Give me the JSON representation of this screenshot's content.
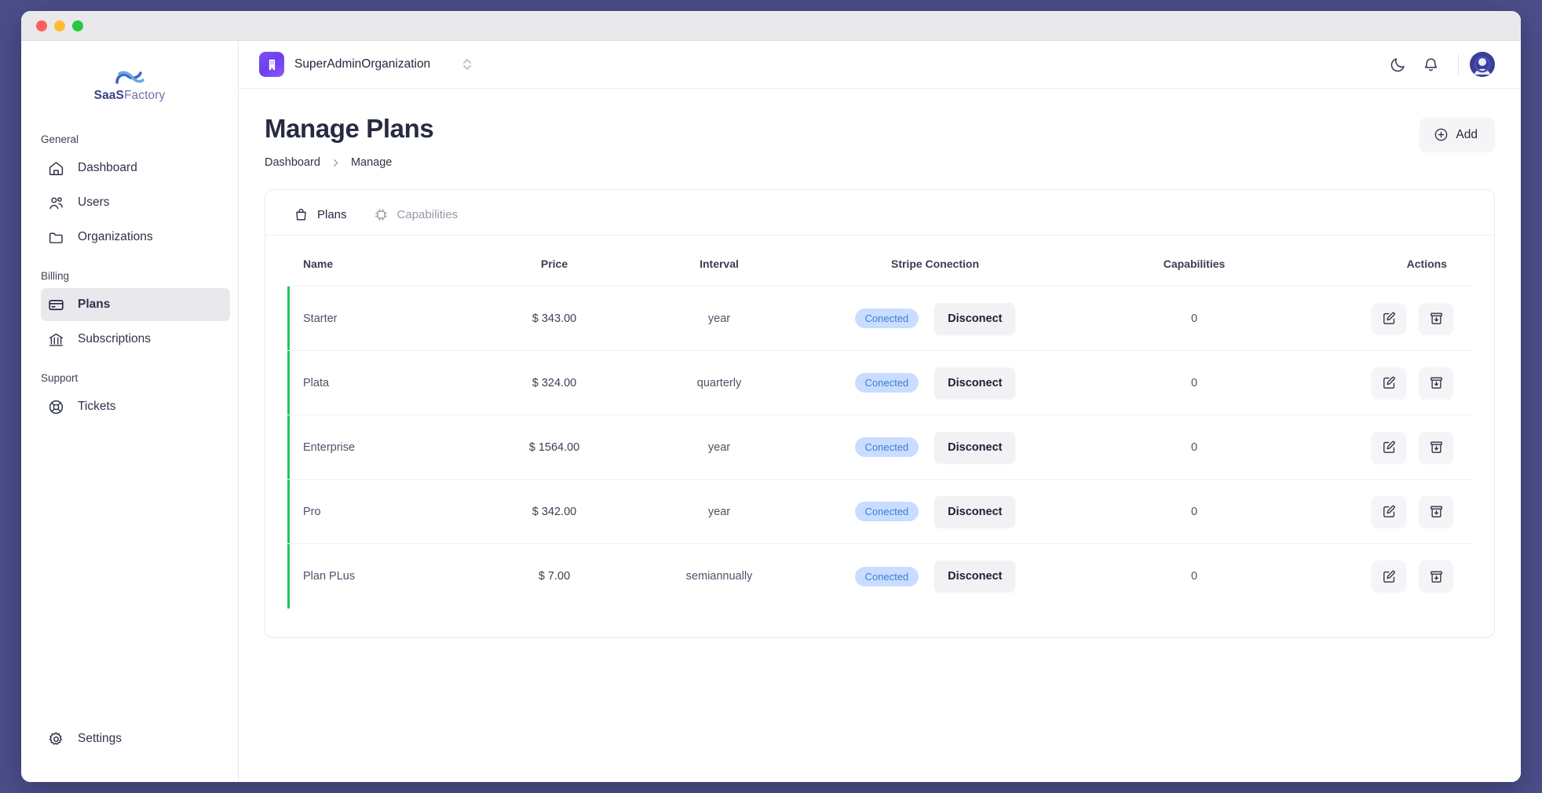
{
  "window": {
    "traffic_lights": [
      "close",
      "minimize",
      "zoom"
    ]
  },
  "sidebar": {
    "logo_bold": "SaaS",
    "logo_light": "Factory",
    "sections": [
      {
        "label": "General",
        "items": [
          {
            "label": "Dashboard",
            "icon": "home-icon",
            "active": false
          },
          {
            "label": "Users",
            "icon": "users-icon",
            "active": false
          },
          {
            "label": "Organizations",
            "icon": "folder-icon",
            "active": false
          }
        ]
      },
      {
        "label": "Billing",
        "items": [
          {
            "label": "Plans",
            "icon": "credit-card-icon",
            "active": true
          },
          {
            "label": "Subscriptions",
            "icon": "bank-icon",
            "active": false
          }
        ]
      },
      {
        "label": "Support",
        "items": [
          {
            "label": "Tickets",
            "icon": "lifebuoy-icon",
            "active": false
          }
        ]
      }
    ],
    "footer": {
      "label": "Settings",
      "icon": "gear-icon"
    }
  },
  "topbar": {
    "org_name": "SuperAdminOrganization",
    "org_icon": "building-icon",
    "theme_toggle_icon": "moon-icon",
    "notifications_icon": "bell-icon",
    "avatar_icon": "user-avatar"
  },
  "page": {
    "title": "Manage Plans",
    "breadcrumb": [
      "Dashboard",
      "Manage"
    ],
    "add_label": "Add",
    "add_icon": "plus-circle-icon"
  },
  "tabs": [
    {
      "label": "Plans",
      "icon": "bag-icon",
      "active": true
    },
    {
      "label": "Capabilities",
      "icon": "chip-icon",
      "active": false
    }
  ],
  "table": {
    "columns": [
      "Name",
      "Price",
      "Interval",
      "Stripe Conection",
      "Capabilities",
      "Actions"
    ],
    "rows": [
      {
        "name": "Starter",
        "price": "$ 343.00",
        "interval": "year",
        "stripe_status": "Conected",
        "stripe_action": "Disconect",
        "capabilities": "0",
        "actions": [
          "edit-icon",
          "archive-icon"
        ]
      },
      {
        "name": "Plata",
        "price": "$ 324.00",
        "interval": "quarterly",
        "stripe_status": "Conected",
        "stripe_action": "Disconect",
        "capabilities": "0",
        "actions": [
          "edit-icon",
          "archive-icon"
        ]
      },
      {
        "name": "Enterprise",
        "price": "$ 1564.00",
        "interval": "year",
        "stripe_status": "Conected",
        "stripe_action": "Disconect",
        "capabilities": "0",
        "actions": [
          "edit-icon",
          "archive-icon"
        ]
      },
      {
        "name": "Pro",
        "price": "$ 342.00",
        "interval": "year",
        "stripe_status": "Conected",
        "stripe_action": "Disconect",
        "capabilities": "0",
        "actions": [
          "edit-icon",
          "archive-icon"
        ]
      },
      {
        "name": "Plan PLus",
        "price": "$ 7.00",
        "interval": "semiannually",
        "stripe_status": "Conected",
        "stripe_action": "Disconect",
        "capabilities": "0",
        "actions": [
          "edit-icon",
          "archive-icon"
        ]
      }
    ]
  },
  "colors": {
    "desktop": "#4b4e8a",
    "accent_green": "#22c55e",
    "badge_bg": "#c8ddff",
    "badge_text": "#3e7dd8",
    "org_badge": "#7c53f0",
    "avatar": "#3b3f99"
  }
}
